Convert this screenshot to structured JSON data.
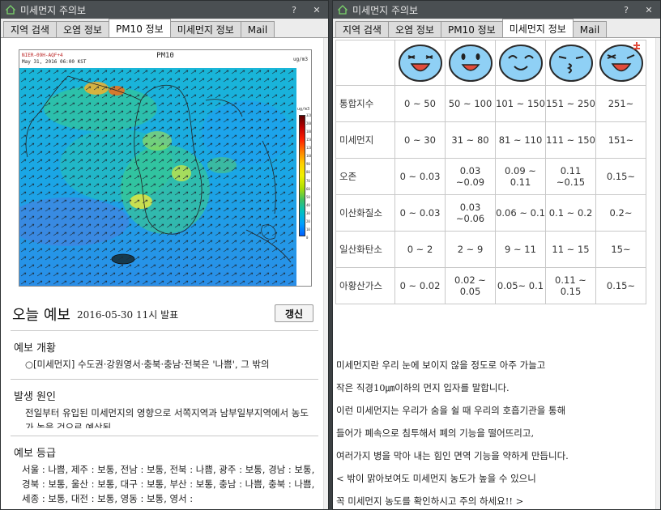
{
  "left_window": {
    "title": "미세먼지 주의보",
    "help_button": "?",
    "close_button": "✕",
    "tabs": [
      "지역 검색",
      "오염 정보",
      "PM10 정보",
      "미세먼지 정보",
      "Mail"
    ],
    "active_tab": 2,
    "map": {
      "title": "PM10",
      "caption_line1": "NIER-09H-AQF+4",
      "caption_line2": "May 31, 2016 06:00 KST",
      "caption_right": "ug/m3",
      "unit": "ug/m3",
      "colorbar_ticks": [
        "320",
        "200",
        "180",
        "150",
        "120",
        "100",
        "90",
        "80",
        "70",
        "60",
        "50",
        "40",
        "30",
        "20",
        "10",
        "0"
      ]
    },
    "forecast": {
      "title": "오늘 예보",
      "date": "2016-05-30 11시 발표",
      "refresh_label": "갱신"
    },
    "sections": [
      {
        "title": "예보 개황",
        "body": "○[미세먼지] 수도권·강원영서·충북·충남·전북은 '나쁨', 그 밖의"
      },
      {
        "title": "발생 원인",
        "body": "전일부터 유입된 미세먼지의 영향으로 서쪽지역과 남부일부지역에서 농도가 높을 것으로 예상됨"
      },
      {
        "title": "예보 등급",
        "body": "서울 : 나쁨, 제주 : 보통, 전남 : 보통, 전북 : 나쁨, 광주 : 보통, 경남 : 보통, 경북 : 보통, 울산 : 보통, 대구 : 보통, 부산 : 보통, 충남 : 나쁨, 충북 : 나쁨, 세종 : 보통, 대전 : 보통, 영동 : 보통, 영서 :"
      }
    ]
  },
  "right_window": {
    "title": "미세먼지 주의보",
    "help_button": "?",
    "close_button": "✕",
    "tabs": [
      "지역 검색",
      "오염 정보",
      "PM10 정보",
      "미세먼지 정보",
      "Mail"
    ],
    "active_tab": 3,
    "face_colors": [
      "#8fd0f5",
      "#8fd0f5",
      "#8fd0f5",
      "#8fd0f5",
      "#8fd0f5"
    ],
    "table_rows": [
      {
        "label": "통합지수",
        "values": [
          "0 ~ 50",
          "50 ~ 100",
          "101 ~ 150",
          "151 ~ 250",
          "251~"
        ]
      },
      {
        "label": "미세먼지",
        "values": [
          "0 ~ 30",
          "31 ~ 80",
          "81 ~ 110",
          "111 ~ 150",
          "151~"
        ]
      },
      {
        "label": "오존",
        "values": [
          "0 ~ 0.03",
          "0.03 ~0.09",
          "0.09 ~ 0.11",
          "0.11 ~0.15",
          "0.15~"
        ]
      },
      {
        "label": "이산화질소",
        "values": [
          "0 ~ 0.03",
          "0.03 ~0.06",
          "0.06 ~ 0.1",
          "0.1 ~ 0.2",
          "0.2~"
        ]
      },
      {
        "label": "일산화탄소",
        "values": [
          "0 ~ 2",
          "2 ~ 9",
          "9 ~ 11",
          "11 ~ 15",
          "15~"
        ]
      },
      {
        "label": "아황산가스",
        "values": [
          "0 ~ 0.02",
          "0.02 ~ 0.05",
          "0.05~ 0.1",
          "0.11 ~ 0.15",
          "0.15~"
        ]
      }
    ],
    "info_lines": [
      "미세먼지란 우리 눈에 보이지 않을 정도로 아주 가늘고",
      "작은 직경10㎛이하의 먼지 입자를 말합니다.",
      "이런 미세먼지는 우리가 숨을 쉴 때 우리의 호흡기관을 통해",
      "들어가 폐속으로 침투해서 폐의 기능을 떨어뜨리고,",
      "여러가지 병을 막아 내는 힘인 면역 기능을 약하게 만듭니다.",
      "< 밖이 맑아보여도 미세먼지 농도가 높을 수 있으니",
      "꼭 미세먼지 농도를 확인하시고 주의 하세요!! >"
    ]
  }
}
